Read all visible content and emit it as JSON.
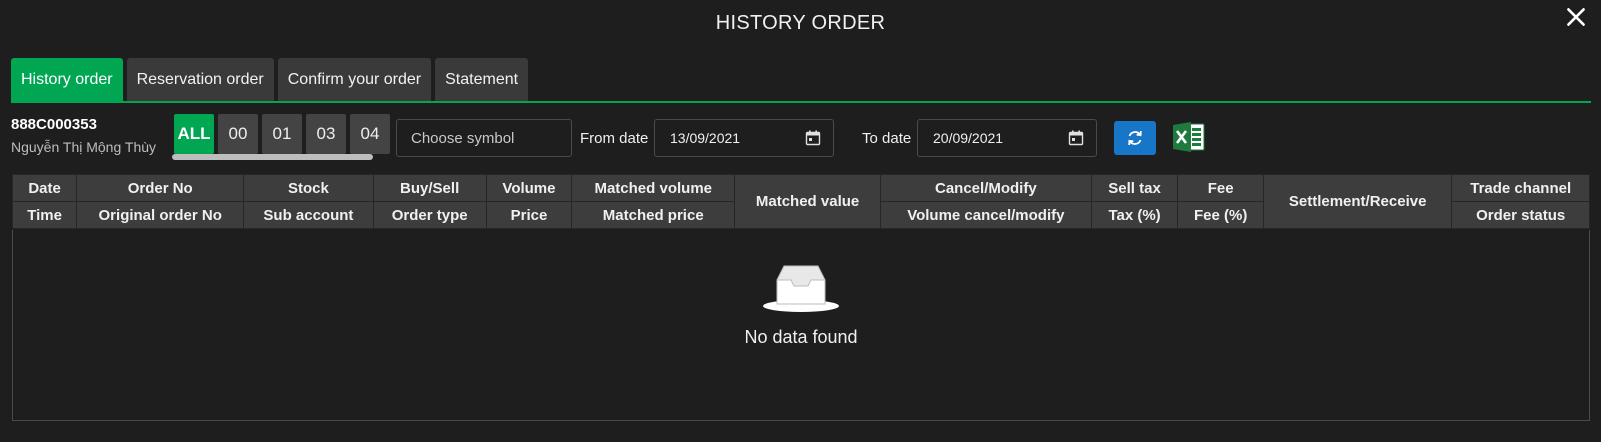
{
  "window": {
    "title": "HISTORY ORDER",
    "close_icon": "close-icon"
  },
  "tabs": [
    {
      "label": "History order",
      "active": true
    },
    {
      "label": "Reservation order",
      "active": false
    },
    {
      "label": "Confirm your order",
      "active": false
    },
    {
      "label": "Statement",
      "active": false
    }
  ],
  "account": {
    "id": "888C000353",
    "name": "Nguyễn Thị Mộng Thùy"
  },
  "sub_accounts": [
    "ALL",
    "00",
    "01",
    "03",
    "04"
  ],
  "filters": {
    "symbol_placeholder": "Choose symbol",
    "from_label": "From date",
    "from_value": "13/09/2021",
    "to_label": "To date",
    "to_value": "20/09/2021"
  },
  "table": {
    "row1": [
      "Date",
      "Order No",
      "Stock",
      "Buy/Sell",
      "Volume",
      "Matched volume",
      "Matched value",
      "Cancel/Modify",
      "Sell tax",
      "Fee",
      "Settlement/Receive",
      "Trade channel"
    ],
    "row2": [
      "Time",
      "Original order No",
      "Sub account",
      "Order type",
      "Price",
      "Matched price",
      "Volume cancel/modify",
      "Tax (%)",
      "Fee (%)",
      "Order status"
    ],
    "empty_text": "No data found"
  },
  "colors": {
    "accent": "#00a651",
    "refresh": "#1776c8",
    "excel": "#1f7a3e"
  }
}
